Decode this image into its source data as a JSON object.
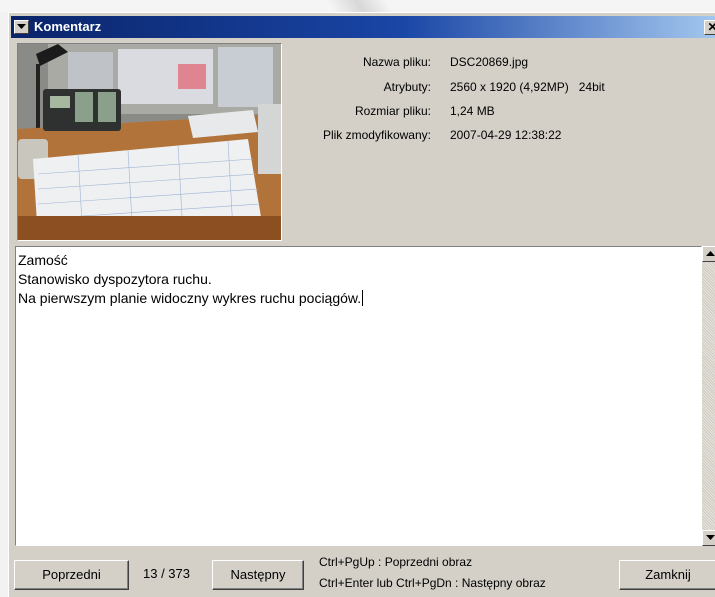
{
  "window": {
    "title": "Komentarz",
    "close_glyph": "✕"
  },
  "file_info": {
    "name_label": "Nazwa pliku:",
    "name_value": "DSC20869.jpg",
    "attributes_label": "Atrybuty:",
    "attributes_value": "2560 x 1920 (4,92MP)   24bit",
    "size_label": "Rozmiar pliku:",
    "size_value": "1,24 MB",
    "modified_label": "Plik zmodyfikowany:",
    "modified_value": "2007-04-29 12:38:22"
  },
  "comment": {
    "lines": [
      "Zamość",
      "Stanowisko dyspozytora ruchu.",
      "Na pierwszym planie widoczny wykres ruchu pociągów."
    ]
  },
  "footer": {
    "prev_label": "Poprzedni",
    "counter": "13 / 373",
    "next_label": "Następny",
    "hint_prev": "Ctrl+PgUp :  Poprzedni obraz",
    "hint_next": "Ctrl+Enter lub Ctrl+PgDn :  Następny obraz",
    "close_label": "Zamknij"
  },
  "colors": {
    "titlebar_start": "#0a246a",
    "titlebar_end": "#a6caf0",
    "window_face": "#d4d0c8"
  }
}
